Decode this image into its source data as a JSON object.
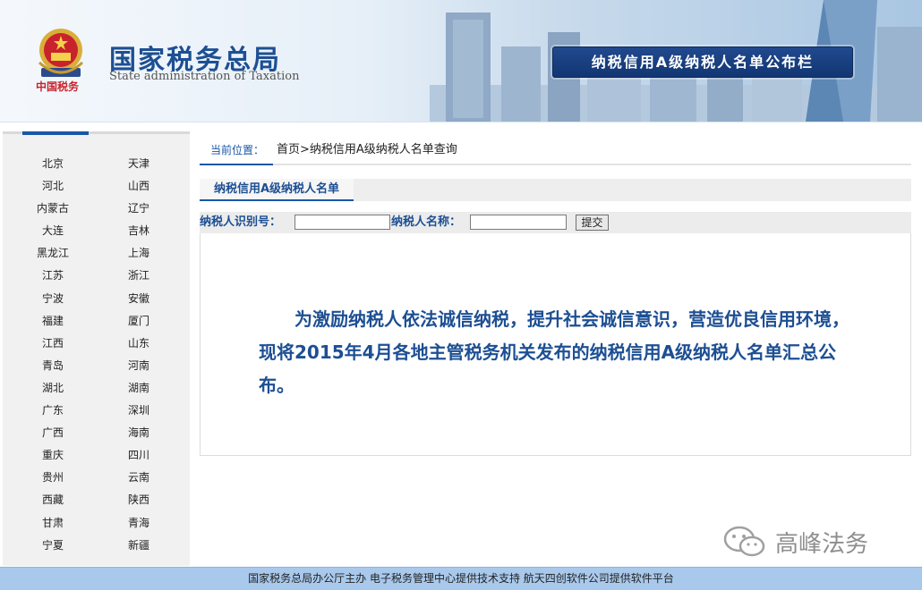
{
  "header": {
    "org_name_cn": "国家税务总局",
    "org_name_en": "State administration of Taxation",
    "emblem_caption": "中国税务",
    "banner_title": "纳税信用A级纳税人名单公布栏"
  },
  "sidebar": {
    "cities": [
      "北京",
      "天津",
      "河北",
      "山西",
      "内蒙古",
      "辽宁",
      "大连",
      "吉林",
      "黑龙江",
      "上海",
      "江苏",
      "浙江",
      "宁波",
      "安徽",
      "福建",
      "厦门",
      "江西",
      "山东",
      "青岛",
      "河南",
      "湖北",
      "湖南",
      "广东",
      "深圳",
      "广西",
      "海南",
      "重庆",
      "四川",
      "贵州",
      "云南",
      "西藏",
      "陕西",
      "甘肃",
      "青海",
      "宁夏",
      "新疆"
    ]
  },
  "breadcrumb": {
    "label": "当前位置：",
    "path": "首页>纳税信用A级纳税人名单查询"
  },
  "section": {
    "title": "纳税信用A级纳税人名单"
  },
  "search": {
    "taxpayer_id_label": "纳税人识别号：",
    "taxpayer_id_value": "",
    "taxpayer_name_label": "纳税人名称：",
    "taxpayer_name_value": "",
    "submit_label": "提交"
  },
  "notice": {
    "text": "为激励纳税人依法诚信纳税，提升社会诚信意识，营造优良信用环境，现将2015年4月各地主管税务机关发布的纳税信用A级纳税人名单汇总公布。"
  },
  "watermark": {
    "text": "高峰法务"
  },
  "footer": {
    "text": "国家税务总局办公厅主办 电子税务管理中心提供技术支持 航天四创软件公司提供软件平台"
  },
  "colors": {
    "primary": "#1a56a8",
    "text_blue": "#1d4f93",
    "banner": "#1b3f80",
    "footer_bg": "#a9c9ec"
  }
}
